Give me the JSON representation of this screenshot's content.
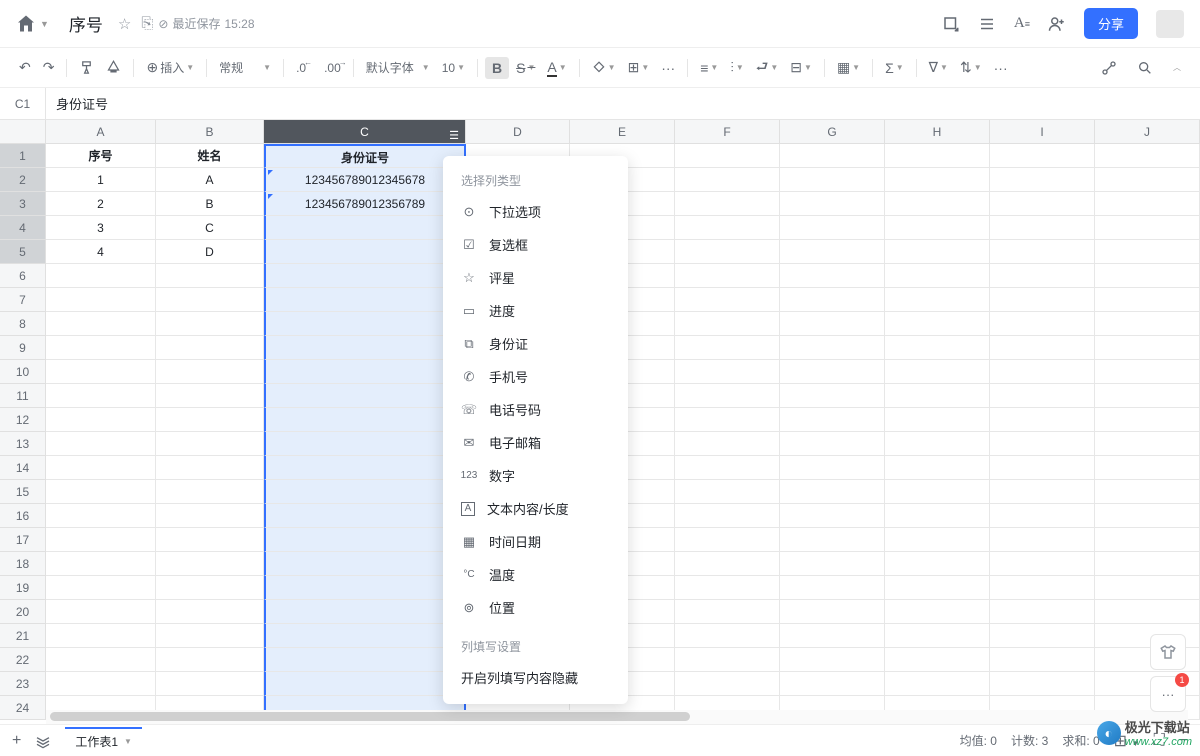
{
  "titlebar": {
    "doc_title": "序号",
    "save_status_prefix": "最近保存",
    "save_time": "15:28",
    "share_label": "分享"
  },
  "toolbar": {
    "insert_label": "插入",
    "style_label": "常规",
    "decimal_label": ".0",
    "decimal2_label": ".00",
    "font_label": "默认字体",
    "font_size": "10",
    "bold_label": "B",
    "font_color_label": "A",
    "more_label": "···"
  },
  "formula": {
    "cell_ref": "C1",
    "value": "身份证号"
  },
  "columns": [
    "A",
    "B",
    "C",
    "D",
    "E",
    "F",
    "G",
    "H",
    "I",
    "J"
  ],
  "header_row": [
    "序号",
    "姓名",
    "身份证号"
  ],
  "data_rows": [
    [
      "1",
      "A",
      "123456789012345678"
    ],
    [
      "2",
      "B",
      "123456789012356789"
    ],
    [
      "3",
      "C",
      ""
    ],
    [
      "4",
      "D",
      ""
    ]
  ],
  "context_menu": {
    "section_title": "选择列类型",
    "items": [
      {
        "icon": "⊙",
        "label": "下拉选项"
      },
      {
        "icon": "☑",
        "label": "复选框"
      },
      {
        "icon": "☆",
        "label": "评星"
      },
      {
        "icon": "▭",
        "label": "进度"
      },
      {
        "icon": "⧉",
        "label": "身份证"
      },
      {
        "icon": "✆",
        "label": "手机号"
      },
      {
        "icon": "☏",
        "label": "电话号码"
      },
      {
        "icon": "✉",
        "label": "电子邮箱"
      },
      {
        "icon": "123",
        "label": "数字"
      },
      {
        "icon": "A",
        "label": "文本内容/长度"
      },
      {
        "icon": "▦",
        "label": "时间日期"
      },
      {
        "icon": "°C",
        "label": "温度"
      },
      {
        "icon": "⊚",
        "label": "位置"
      }
    ],
    "section2_title": "列填写设置",
    "hidden_content": "开启列填写内容隐藏"
  },
  "statusbar": {
    "sheet_name": "工作表1",
    "avg_label": "均值: 0",
    "count_label": "计数: 3",
    "sum_label": "求和: 0"
  },
  "watermark": {
    "text1": "极光下载站",
    "text2": "www.xz7.com"
  },
  "float_badge": "1"
}
